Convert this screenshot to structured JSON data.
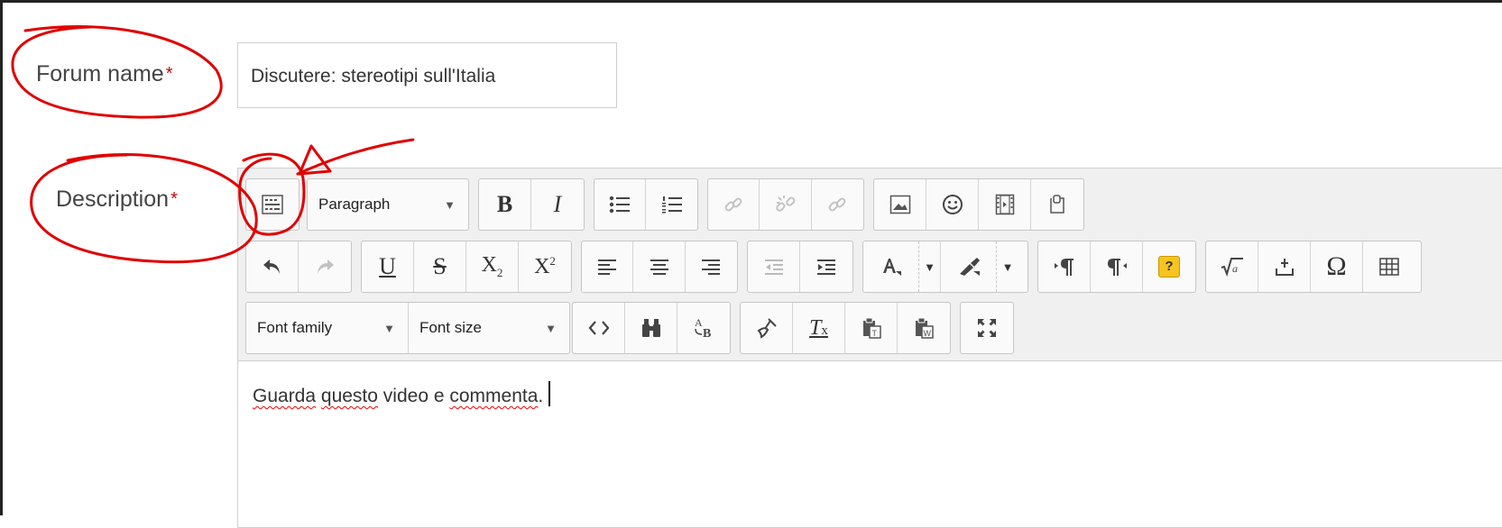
{
  "form": {
    "forum_name_label": "Forum name",
    "forum_name_value": "Discutere: stereotipi sull'Italia",
    "description_label": "Description",
    "required_marker": "*"
  },
  "toolbar": {
    "format_select": "Paragraph",
    "font_family_select": "Font family",
    "font_size_select": "Font size",
    "help_badge": "?"
  },
  "content": {
    "words": [
      "Guarda",
      "questo",
      "video e",
      "commenta",
      "."
    ]
  },
  "colors": {
    "required": "#c40000",
    "annotation": "#e00000",
    "toolbar_bg": "#f0f0f0"
  }
}
